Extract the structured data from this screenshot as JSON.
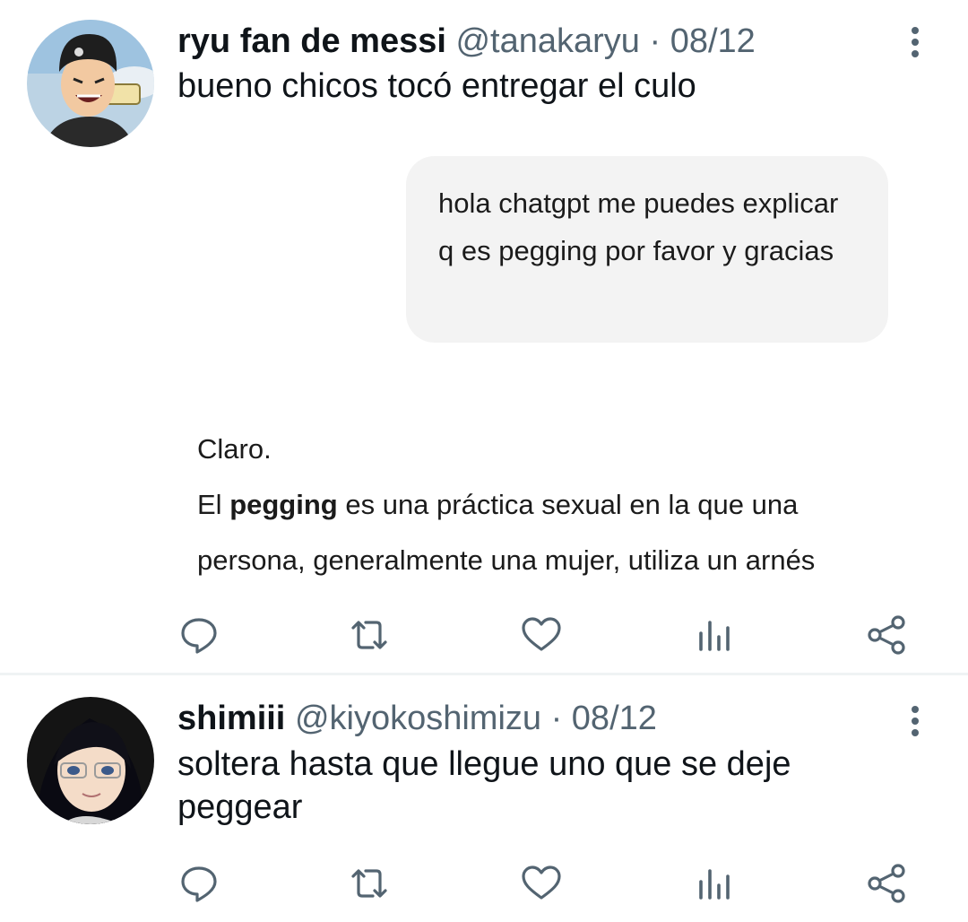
{
  "tweets": [
    {
      "name": "ryu fan de messi",
      "meta": "@tanakaryu · 08/12",
      "text": "bueno chicos tocó entregar el culo",
      "media": {
        "bubble_text": "hola chatgpt me puedes explicar q es pegging por favor y gracias",
        "reply_line1": "Claro.",
        "reply_line2_pre": "El ",
        "reply_line2_bold": "pegging",
        "reply_line2_post": " es una práctica sexual en la que una",
        "reply_line3": "persona, generalmente una mujer, utiliza un arnés"
      }
    },
    {
      "name": "shimiii",
      "meta": "@kiyokoshimizu · 08/12",
      "text": "soltera hasta que llegue uno que se deje peggear"
    }
  ],
  "icons": [
    "reply-icon",
    "retweet-icon",
    "like-icon",
    "analytics-icon",
    "share-icon",
    "more-icon"
  ],
  "colors": {
    "icon": "#536471",
    "text": "#0f1419",
    "divider": "#eff3f4",
    "bubble": "#f3f3f3"
  }
}
